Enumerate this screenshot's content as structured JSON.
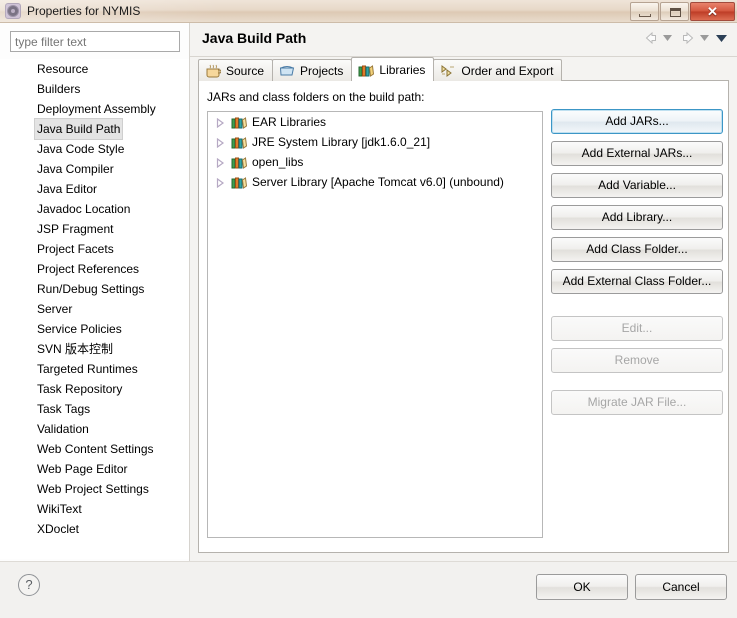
{
  "window": {
    "title": "Properties for NYMIS",
    "icon": "properties-icon",
    "controls": {
      "minimize": "minimize-icon",
      "maximize": "maximize-icon",
      "close": "✕"
    }
  },
  "sidebar": {
    "filter": {
      "value": "",
      "placeholder": "type filter text"
    },
    "selected": "Java Build Path",
    "items": [
      {
        "label": "Resource"
      },
      {
        "label": "Builders"
      },
      {
        "label": "Deployment Assembly"
      },
      {
        "label": "Java Build Path"
      },
      {
        "label": "Java Code Style"
      },
      {
        "label": "Java Compiler"
      },
      {
        "label": "Java Editor"
      },
      {
        "label": "Javadoc Location"
      },
      {
        "label": "JSP Fragment"
      },
      {
        "label": "Project Facets"
      },
      {
        "label": "Project References"
      },
      {
        "label": "Run/Debug Settings"
      },
      {
        "label": "Server"
      },
      {
        "label": "Service Policies"
      },
      {
        "label": "SVN 版本控制"
      },
      {
        "label": "Targeted Runtimes"
      },
      {
        "label": "Task Repository"
      },
      {
        "label": "Task Tags"
      },
      {
        "label": "Validation"
      },
      {
        "label": "Web Content Settings"
      },
      {
        "label": "Web Page Editor"
      },
      {
        "label": "Web Project Settings"
      },
      {
        "label": "WikiText"
      },
      {
        "label": "XDoclet"
      }
    ]
  },
  "page": {
    "title": "Java Build Path",
    "nav": {
      "back": "back-arrow-icon",
      "back_menu": "chevron-down-icon",
      "forward": "forward-arrow-icon",
      "forward_menu": "chevron-down-icon",
      "view_menu": "chevron-down-icon"
    },
    "tabs": [
      {
        "label": "Source",
        "icon": "source-folder-icon",
        "active": false
      },
      {
        "label": "Projects",
        "icon": "projects-icon",
        "active": false
      },
      {
        "label": "Libraries",
        "icon": "libraries-icon",
        "active": true
      },
      {
        "label": "Order and Export",
        "icon": "order-export-icon",
        "active": false
      }
    ],
    "libraries": {
      "caption": "JARs and class folders on the build path:",
      "entries": [
        {
          "label": "EAR Libraries",
          "icon": "library-icon",
          "expandable": true
        },
        {
          "label": "JRE System Library [jdk1.6.0_21]",
          "icon": "library-icon",
          "expandable": true
        },
        {
          "label": "open_libs",
          "icon": "library-icon",
          "expandable": true
        },
        {
          "label": "Server Library [Apache Tomcat v6.0] (unbound)",
          "icon": "library-icon",
          "expandable": true
        }
      ]
    },
    "actions": [
      {
        "label": "Add JARs...",
        "state": "focused"
      },
      {
        "label": "Add External JARs...",
        "state": "enabled"
      },
      {
        "label": "Add Variable...",
        "state": "enabled"
      },
      {
        "label": "Add Library...",
        "state": "enabled"
      },
      {
        "label": "Add Class Folder...",
        "state": "enabled"
      },
      {
        "label": "Add External Class Folder...",
        "state": "enabled"
      },
      {
        "label": "Edit...",
        "state": "disabled"
      },
      {
        "label": "Remove",
        "state": "disabled"
      },
      {
        "label": "Migrate JAR File...",
        "state": "disabled"
      }
    ]
  },
  "footer": {
    "help": "?",
    "ok_label": "OK",
    "cancel_label": "Cancel"
  },
  "colors": {
    "focus_blue": "#3c96c6",
    "titlebar": "#e7d8c8",
    "close_red": "#bd3c26",
    "panel_bg": "#f4f3f1"
  }
}
